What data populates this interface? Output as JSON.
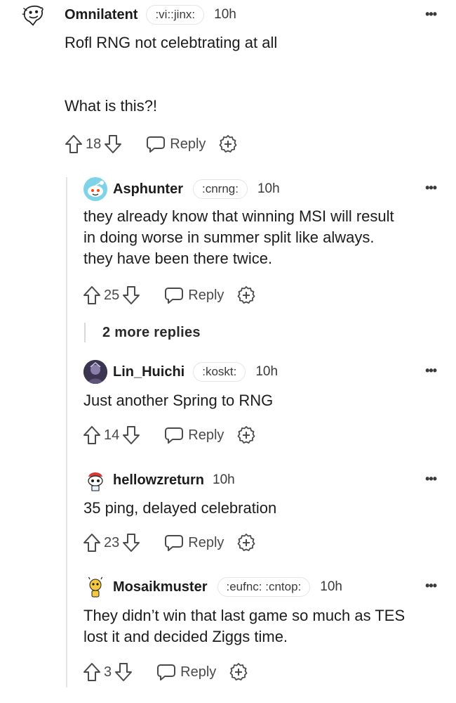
{
  "comments": [
    {
      "username": "Omnilatent",
      "flair": ":vi::jinx:",
      "time": "10h",
      "text": "Rofl RNG not celebtrating at all\n\n\nWhat is this?!",
      "votes": "18",
      "reply_label": "Reply",
      "avatar_icon": "sketch-face-icon"
    },
    {
      "username": "Asphunter",
      "flair": ":cnrng:",
      "time": "10h",
      "text": "they already know that winning MSI will result\nin doing worse in summer split like always.\nthey have been there twice.",
      "votes": "25",
      "reply_label": "Reply",
      "avatar_icon": "snoo-avatar-icon"
    },
    {
      "username": "Lin_Huichi",
      "flair": ":koskt:",
      "time": "10h",
      "text": "Just another Spring to RNG",
      "votes": "14",
      "reply_label": "Reply",
      "avatar_icon": "character-avatar-icon"
    },
    {
      "username": "hellowzreturn",
      "flair": "",
      "time": "10h",
      "text": "35 ping, delayed celebration",
      "votes": "23",
      "reply_label": "Reply",
      "avatar_icon": "snoo-red-hat-icon"
    },
    {
      "username": "Mosaikmuster",
      "flair": ":eufnc: :cntop:",
      "time": "10h",
      "text": "They didn’t win that last game so much as TES\nlost it and decided Ziggs time.",
      "votes": "3",
      "reply_label": "Reply",
      "avatar_icon": "snoo-yellow-icon"
    }
  ],
  "more_replies_label": "2 more replies",
  "colors": {
    "text": "#1c1c1c",
    "muted": "#4a4a4a",
    "thread_line": "#e3e5e8"
  }
}
